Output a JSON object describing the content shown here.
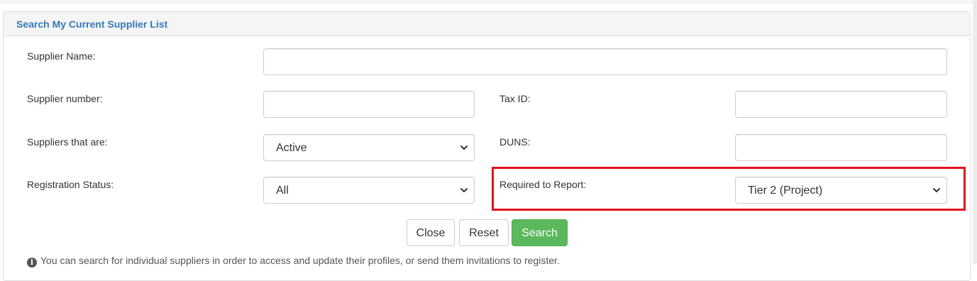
{
  "panel": {
    "title": "Search My Current Supplier List"
  },
  "form": {
    "supplier_name": {
      "label": "Supplier Name:",
      "value": "",
      "placeholder": ""
    },
    "supplier_number": {
      "label": "Supplier number:",
      "value": "",
      "placeholder": ""
    },
    "tax_id": {
      "label": "Tax ID:",
      "value": "",
      "placeholder": ""
    },
    "suppliers_that_are": {
      "label": "Suppliers that are:",
      "selected": "Active"
    },
    "duns": {
      "label": "DUNS:",
      "value": "",
      "placeholder": ""
    },
    "registration_status": {
      "label": "Registration Status:",
      "selected": "All"
    },
    "required_to_report": {
      "label": "Required to Report:",
      "selected": "Tier 2 (Project)"
    }
  },
  "buttons": {
    "close": "Close",
    "reset": "Reset",
    "search": "Search"
  },
  "info": {
    "icon": "info-circle-icon",
    "text": "You can search for individual suppliers in order to access and update their profiles, or send them invitations to register."
  },
  "colors": {
    "title": "#337ab7",
    "highlight_border": "#e0121f",
    "search_button": "#5cb85c"
  }
}
